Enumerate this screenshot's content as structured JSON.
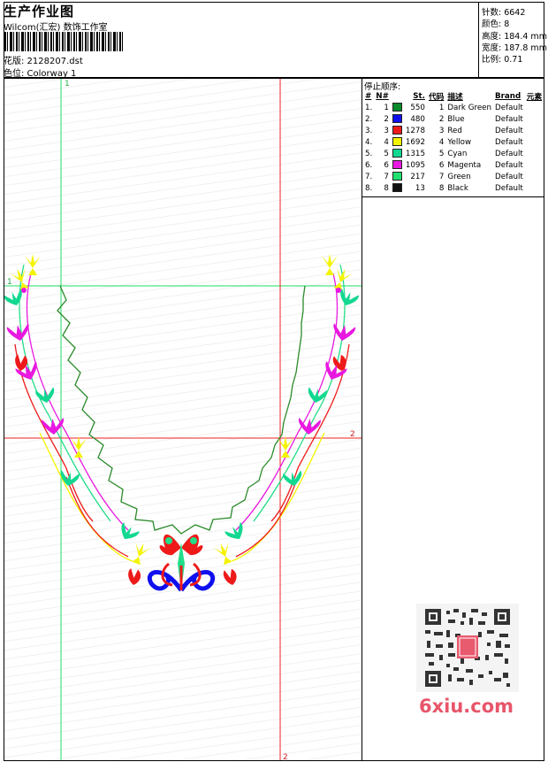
{
  "header": {
    "title": "生产作业图",
    "company": "Wilcom(汇宏) 数饰工作室",
    "design_label": "花版: 2128207.dst",
    "colorway_label": "色位: Colorway 1"
  },
  "stats": {
    "stitches": "针数: 6642",
    "colors": "颜色: 8",
    "height": "高度: 184.4 mm",
    "width": "宽度: 187.8 mm",
    "scale": "比例: 0.71"
  },
  "stop_sequence": {
    "title": "停止顺序:",
    "headers": [
      "#",
      "N#",
      "St.",
      "代码",
      "描述",
      "Brand",
      "元素"
    ],
    "rows": [
      {
        "idx": "1.",
        "n": "1",
        "st": "550",
        "code": "1",
        "desc": "Dark Green",
        "brand": "Default",
        "color": "#0a8a2a"
      },
      {
        "idx": "2.",
        "n": "2",
        "st": "480",
        "code": "2",
        "desc": "Blue",
        "brand": "Default",
        "color": "#1010ee"
      },
      {
        "idx": "3.",
        "n": "3",
        "st": "1278",
        "code": "3",
        "desc": "Red",
        "brand": "Default",
        "color": "#ee1a1a"
      },
      {
        "idx": "4.",
        "n": "4",
        "st": "1692",
        "code": "4",
        "desc": "Yellow",
        "brand": "Default",
        "color": "#f4f400"
      },
      {
        "idx": "5.",
        "n": "5",
        "st": "1315",
        "code": "5",
        "desc": "Cyan",
        "brand": "Default",
        "color": "#12d890"
      },
      {
        "idx": "6.",
        "n": "6",
        "st": "1095",
        "code": "6",
        "desc": "Magenta",
        "brand": "Default",
        "color": "#e818e0"
      },
      {
        "idx": "7.",
        "n": "7",
        "st": "217",
        "code": "7",
        "desc": "Green",
        "brand": "Default",
        "color": "#22e070"
      },
      {
        "idx": "8.",
        "n": "8",
        "st": "13",
        "code": "8",
        "desc": "Black",
        "brand": "Default",
        "color": "#111111"
      }
    ]
  },
  "guides": {
    "v_green_label": "1",
    "h_green_label": "1",
    "h_red_label": "2",
    "v_red_label": "2"
  },
  "watermark": "6xiu.com"
}
